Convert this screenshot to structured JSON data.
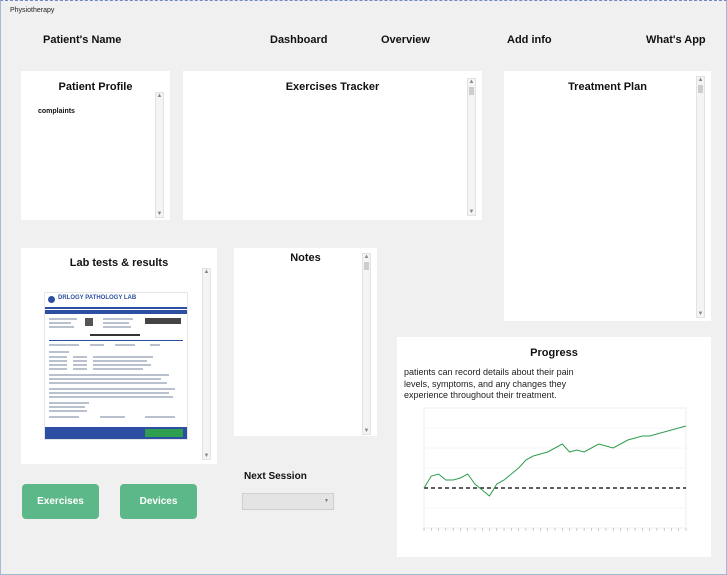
{
  "window": {
    "title": "Physiotherapy"
  },
  "nav": {
    "patient_name": "Patient's Name",
    "dashboard": "Dashboard",
    "overview": "Overview",
    "add_info": "Add info",
    "whats_app": "What's App"
  },
  "panels": {
    "patient_profile": {
      "title": "Patient Profile",
      "field": "complaints"
    },
    "exercises_tracker": {
      "title": "Exercises Tracker"
    },
    "treatment_plan": {
      "title": "Treatment Plan"
    },
    "lab_tests": {
      "title": "Lab tests & results",
      "report_lab_name": "DRLOGY PATHOLOGY LAB"
    },
    "notes": {
      "title": "Notes"
    },
    "progress": {
      "title": "Progress",
      "description": "patients can record details about their pain levels, symptoms, and any changes they experience throughout their treatment."
    }
  },
  "buttons": {
    "exercises": "Exercises",
    "devices": "Devices"
  },
  "next_session": {
    "label": "Next Session",
    "value": ""
  },
  "colors": {
    "button": "#5cb888",
    "chart_line": "#2e9e4f",
    "baseline": "#000000"
  },
  "chart_data": {
    "type": "line",
    "title": "",
    "xlabel": "",
    "ylabel": "",
    "series": [
      {
        "values": [
          40,
          46,
          47,
          44,
          44,
          45,
          47,
          42,
          39,
          36,
          42,
          44,
          47,
          50,
          54,
          56,
          57,
          58,
          60,
          62,
          58,
          59,
          58,
          60,
          62,
          61,
          60,
          62,
          64,
          65,
          66,
          66,
          67,
          68,
          69,
          70,
          71
        ]
      }
    ],
    "baseline": 40,
    "grid": true,
    "legend": "none"
  }
}
